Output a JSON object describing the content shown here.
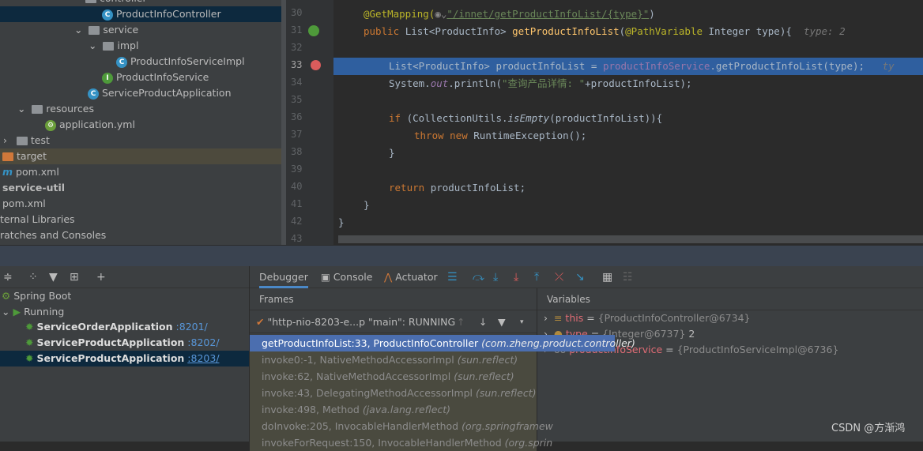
{
  "project_tree": {
    "items": [
      {
        "label": "controller",
        "icon": "folder-icon"
      },
      {
        "label": "ProductInfoController",
        "icon": "class-icon",
        "selected": true
      },
      {
        "label": "service",
        "icon": "package-icon"
      },
      {
        "label": "impl",
        "icon": "package-icon"
      },
      {
        "label": "ProductInfoServiceImpl",
        "icon": "class-icon"
      },
      {
        "label": "ProductInfoService",
        "icon": "interface-icon"
      },
      {
        "label": "ServiceProductApplication",
        "icon": "spring-boot-class-icon"
      },
      {
        "label": "resources",
        "icon": "resources-folder-icon"
      },
      {
        "label": "application.yml",
        "icon": "spring-yaml-icon"
      },
      {
        "label": "test",
        "icon": "folder-icon"
      },
      {
        "label": "target",
        "icon": "excluded-folder-icon"
      },
      {
        "label": "pom.xml",
        "icon": "maven-icon"
      },
      {
        "label": "service-util",
        "icon": "module-icon"
      },
      {
        "label": "pom.xml",
        "icon": "xml-icon"
      },
      {
        "label": "ternal Libraries",
        "icon": "library-icon"
      },
      {
        "label": "ratches and Consoles",
        "icon": "scratches-icon"
      }
    ]
  },
  "editor": {
    "line_numbers": [
      "30",
      "31",
      "32",
      "33",
      "34",
      "35",
      "36",
      "37",
      "38",
      "39",
      "40",
      "41",
      "42",
      "43"
    ],
    "current_line": "33",
    "lines": {
      "l30a": "@GetMapping(",
      "l30b": "\"/innet/getProductInfoList/{type}\"",
      "l30c": ")",
      "l31a": "public ",
      "l31b": "List<ProductInfo> ",
      "l31c": "getProductInfoList",
      "l31d": "(",
      "l31e": "@PathVariable ",
      "l31f": "Integer type){",
      "l31hint": "type: 2",
      "l33a": "List<ProductInfo> productInfoList = ",
      "l33b": "productInfoService",
      "l33c": ".getProductInfoList(type);",
      "l33hint": "ty",
      "l34a": "System.",
      "l34b": "out",
      "l34c": ".println(",
      "l34d": "\"查询产品详情: \"",
      "l34e": "+productInfoList);",
      "l36a": "if ",
      "l36b": "(CollectionUtils.",
      "l36c": "isEmpty",
      "l36d": "(productInfoList)){",
      "l37a": "throw new ",
      "l37b": "RuntimeException();",
      "l38": "}",
      "l40a": "return ",
      "l40b": "productInfoList;",
      "l41": "}",
      "l42": "}"
    }
  },
  "services": {
    "root": "Spring Boot",
    "group": "Running",
    "apps": [
      {
        "name": "ServiceOrderApplication",
        "port": ":8201/"
      },
      {
        "name": "ServiceProductApplication",
        "port": ":8202/"
      },
      {
        "name": "ServiceProductApplication",
        "port": ":8203/",
        "selected": true
      }
    ]
  },
  "debugger": {
    "tabs": [
      "Debugger",
      "Console",
      "Actuator"
    ],
    "frames_title": "Frames",
    "thread": "\"http-nio-8203-e...p \"main\": RUNNING",
    "frames": [
      {
        "method": "getProductInfoList:33, ProductInfoController",
        "pkg": "(com.zheng.product.controller)"
      },
      {
        "method": "invoke0:-1, NativeMethodAccessorImpl",
        "pkg": "(sun.reflect)"
      },
      {
        "method": "invoke:62, NativeMethodAccessorImpl",
        "pkg": "(sun.reflect)"
      },
      {
        "method": "invoke:43, DelegatingMethodAccessorImpl",
        "pkg": "(sun.reflect)"
      },
      {
        "method": "invoke:498, Method",
        "pkg": "(java.lang.reflect)"
      },
      {
        "method": "doInvoke:205, InvocableHandlerMethod",
        "pkg": "(org.springframew"
      },
      {
        "method": "invokeForRequest:150, InvocableHandlerMethod",
        "pkg": "(org.sprin"
      }
    ],
    "variables_title": "Variables",
    "variables": [
      {
        "name": "this",
        "value": "{ProductInfoController@6734}"
      },
      {
        "name": "type",
        "value": "{Integer@6737}",
        "extra": "2"
      },
      {
        "name": "productInfoService",
        "value": "{ProductInfoServiceImpl@6736}"
      }
    ]
  },
  "watermark": "CSDN @方渐鸿",
  "colors": {
    "selection": "#0d293e",
    "exec_line": "#2f5f9f",
    "frame_selected": "#4b6eaf",
    "accent_blue": "#3592c4"
  }
}
